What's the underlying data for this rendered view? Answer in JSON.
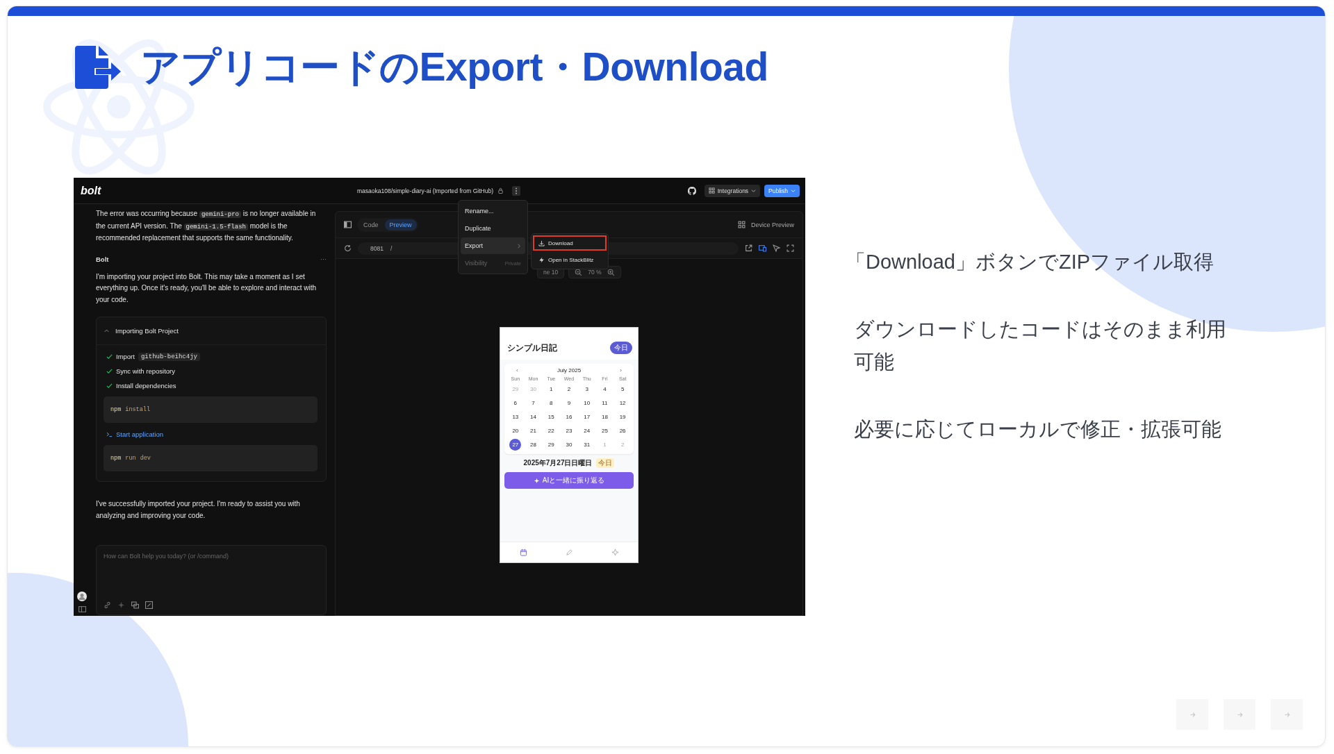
{
  "slide": {
    "title": "アプリコードのExport・Download",
    "bullets": [
      "「Download」ボタンでZIPファイル取得",
      "ダウンロードしたコードはそのまま利用可能",
      "必要に応じてローカルで修正・拡張可能"
    ]
  },
  "app": {
    "logo": "bolt",
    "project_title": "masaoka108/simple-diary-ai (Imported from GitHub)",
    "integrations": "Integrations",
    "publish": "Publish",
    "chat": {
      "intro": [
        {
          "text": "The error was occurring because ",
          "code": false
        },
        {
          "text": "gemini-pro",
          "code": true
        },
        {
          "text": " is no longer available in the current API version. The ",
          "code": false
        },
        {
          "text": "gemini-1.5-flash",
          "code": true
        },
        {
          "text": " model is the recommended replacement that supports the same functionality.",
          "code": false
        }
      ],
      "author": "Bolt",
      "more": "···",
      "message": "I'm importing your project into Bolt. This may take a moment as I set everything up. Once it's ready, you'll be able to explore and interact with your code.",
      "card": {
        "title": "Importing Bolt Project",
        "expanded": true,
        "steps": [
          {
            "label": "Import",
            "code": "github-beihc4jy",
            "done": true
          },
          {
            "label": "Sync with repository",
            "done": true
          },
          {
            "label": "Install dependencies",
            "done": true,
            "command": [
              "npm",
              "install"
            ]
          },
          {
            "label": "Start application",
            "done": false,
            "command": [
              "npm",
              "run",
              "dev"
            ]
          }
        ]
      },
      "closing": "I've successfully imported your project. I'm ready to assist you with analyzing and improving your code.",
      "input": {
        "placeholder": "How can Bolt help you today? (or /command)"
      }
    },
    "preview": {
      "tabs": [
        {
          "label": "Code",
          "selected": false
        },
        {
          "label": "Preview",
          "selected": true
        }
      ],
      "device_preview": "Device Preview",
      "port": "8081",
      "path": "/",
      "device_select": "ne 10",
      "zoom": "70 %"
    },
    "menu": {
      "items": [
        {
          "label": "Rename...",
          "selected": false,
          "disabled": false
        },
        {
          "label": "Duplicate",
          "selected": false,
          "disabled": false
        },
        {
          "label": "Export",
          "selected": true,
          "disabled": false,
          "submenu": true
        },
        {
          "label": "Visibility",
          "value": "Private",
          "selected": false,
          "disabled": true
        }
      ],
      "submenu": [
        {
          "label": "Download",
          "kind": "download",
          "highlighted": true
        },
        {
          "label": "Open in StackBlitz",
          "kind": "bolt",
          "highlighted": false
        }
      ]
    },
    "phone": {
      "title": "シンプル日記",
      "today_button": "今日",
      "month": "July 2025",
      "prev": "‹",
      "next": "›",
      "weekdays": [
        "Sun",
        "Mon",
        "Tue",
        "Wed",
        "Thu",
        "Fri",
        "Sat"
      ],
      "days": [
        {
          "d": "29",
          "outside": true,
          "selected": false
        },
        {
          "d": "30",
          "outside": true,
          "selected": false
        },
        {
          "d": "1",
          "outside": false,
          "selected": false
        },
        {
          "d": "2",
          "outside": false,
          "selected": false
        },
        {
          "d": "3",
          "outside": false,
          "selected": false
        },
        {
          "d": "4",
          "outside": false,
          "selected": false
        },
        {
          "d": "5",
          "outside": false,
          "selected": false
        },
        {
          "d": "6",
          "outside": false,
          "selected": false
        },
        {
          "d": "7",
          "outside": false,
          "selected": false
        },
        {
          "d": "8",
          "outside": false,
          "selected": false
        },
        {
          "d": "9",
          "outside": false,
          "selected": false
        },
        {
          "d": "10",
          "outside": false,
          "selected": false
        },
        {
          "d": "11",
          "outside": false,
          "selected": false
        },
        {
          "d": "12",
          "outside": false,
          "selected": false
        },
        {
          "d": "13",
          "outside": false,
          "selected": false
        },
        {
          "d": "14",
          "outside": false,
          "selected": false
        },
        {
          "d": "15",
          "outside": false,
          "selected": false
        },
        {
          "d": "16",
          "outside": false,
          "selected": false
        },
        {
          "d": "17",
          "outside": false,
          "selected": false
        },
        {
          "d": "18",
          "outside": false,
          "selected": false
        },
        {
          "d": "19",
          "outside": false,
          "selected": false
        },
        {
          "d": "20",
          "outside": false,
          "selected": false
        },
        {
          "d": "21",
          "outside": false,
          "selected": false
        },
        {
          "d": "22",
          "outside": false,
          "selected": false
        },
        {
          "d": "23",
          "outside": false,
          "selected": false
        },
        {
          "d": "24",
          "outside": false,
          "selected": false
        },
        {
          "d": "25",
          "outside": false,
          "selected": false
        },
        {
          "d": "26",
          "outside": false,
          "selected": false
        },
        {
          "d": "27",
          "outside": false,
          "selected": true
        },
        {
          "d": "28",
          "outside": false,
          "selected": false
        },
        {
          "d": "29",
          "outside": false,
          "selected": false
        },
        {
          "d": "30",
          "outside": false,
          "selected": false
        },
        {
          "d": "31",
          "outside": false,
          "selected": false
        },
        {
          "d": "1",
          "outside": true,
          "selected": false
        },
        {
          "d": "2",
          "outside": true,
          "selected": false
        }
      ],
      "date_line": "2025年7月27日日曜日",
      "date_tag": "今日",
      "ai_button": "AIと一緒に振り返る",
      "nav": [
        {
          "kind": "calendar",
          "selected": true
        },
        {
          "kind": "pen",
          "selected": false
        },
        {
          "kind": "sparkle",
          "selected": false
        }
      ]
    }
  }
}
